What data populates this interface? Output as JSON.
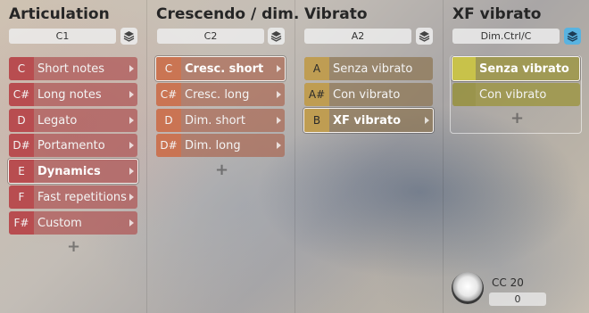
{
  "columns": [
    {
      "title": "Articulation",
      "selector": "C1",
      "rows": [
        {
          "key": "C",
          "label": "Short notes"
        },
        {
          "key": "C#",
          "label": "Long notes"
        },
        {
          "key": "D",
          "label": "Legato"
        },
        {
          "key": "D#",
          "label": "Portamento"
        },
        {
          "key": "E",
          "label": "Dynamics"
        },
        {
          "key": "F",
          "label": "Fast repetitions"
        },
        {
          "key": "F#",
          "label": "Custom"
        }
      ],
      "selected_index": 4
    },
    {
      "title": "Crescendo / dim.",
      "selector": "C2",
      "rows": [
        {
          "key": "C",
          "label": "Cresc. short"
        },
        {
          "key": "C#",
          "label": "Cresc. long"
        },
        {
          "key": "D",
          "label": "Dim. short"
        },
        {
          "key": "D#",
          "label": "Dim. long"
        }
      ],
      "selected_index": 0
    },
    {
      "title": "Vibrato",
      "selector": "A2",
      "rows": [
        {
          "key": "A",
          "label": "Senza vibrato"
        },
        {
          "key": "A#",
          "label": "Con vibrato"
        },
        {
          "key": "B",
          "label": "XF vibrato"
        }
      ],
      "selected_index": 2
    },
    {
      "title": "XF vibrato",
      "selector": "Dim.Ctrl/C",
      "rows": [
        {
          "label": "Senza vibrato"
        },
        {
          "label": "Con vibrato"
        }
      ],
      "selected_index": 0
    }
  ],
  "add_symbol": "+",
  "controller": {
    "label": "CC 20",
    "value": "0"
  },
  "colors": {
    "articulation": "#b9464b",
    "crescendo": "#cd7350",
    "vibrato": "#c3a050",
    "xf": "#c8c24a",
    "active_layer_button": "#59b3e0"
  },
  "icons": {
    "layer": "layers-icon",
    "arrow": "chevron-right-icon",
    "knob": "knob-icon"
  }
}
